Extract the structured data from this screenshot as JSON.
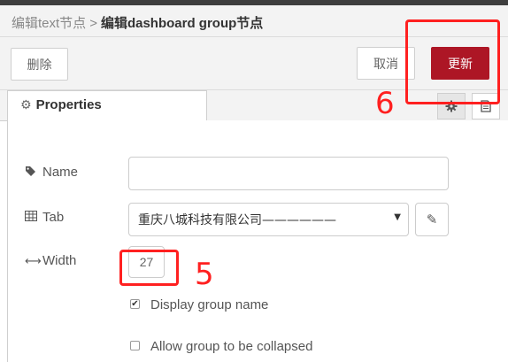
{
  "breadcrumb": {
    "previous": "编辑text节点",
    "separator": ">",
    "current": "编辑dashboard group节点"
  },
  "toolbar": {
    "delete_label": "删除",
    "cancel_label": "取消",
    "update_label": "更新"
  },
  "tabs": [
    {
      "label": "Properties",
      "icon": "gear-icon"
    }
  ],
  "side_icons": [
    "settings-icon",
    "document-icon"
  ],
  "form": {
    "name": {
      "label": "Name",
      "icon": "tag-icon",
      "value": "",
      "placeholder": ""
    },
    "tab": {
      "label": "Tab",
      "icon": "table-icon",
      "selected": "重庆八城科技有限公司——————"
    },
    "width": {
      "label": "Width",
      "icon": "arrows-horizontal-icon",
      "value": "27"
    },
    "display_group_name": {
      "label": "Display group name",
      "checked": true
    },
    "collapsible": {
      "label": "Allow group to be collapsed",
      "checked": false
    }
  },
  "annotations": {
    "update_marker": "6",
    "width_marker": "5",
    "color": "#ff2020"
  },
  "colors": {
    "primary_button": "#ad1625",
    "header_bg": "#f3f3f3",
    "topbar": "#3e3e3e"
  }
}
